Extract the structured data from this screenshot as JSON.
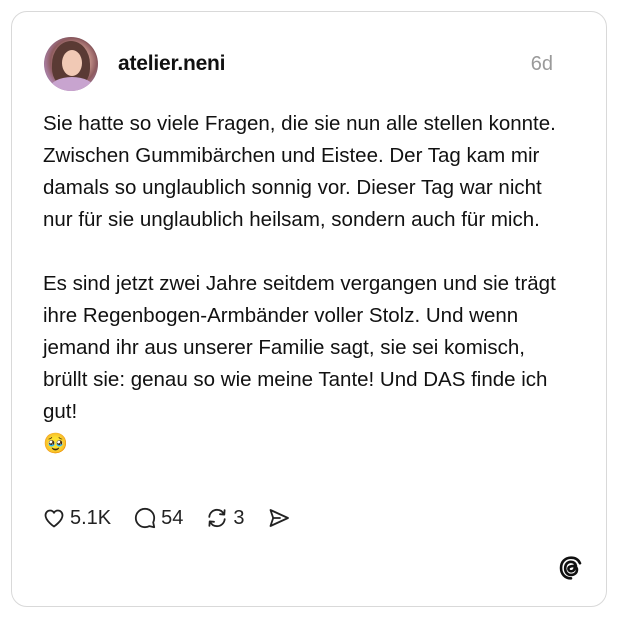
{
  "post": {
    "username": "atelier.neni",
    "timestamp": "6d",
    "paragraph_1": "Sie hatte so viele Fragen, die sie nun alle stellen konnte. Zwischen Gummibärchen und Eistee. Der Tag kam mir damals so unglaublich sonnig vor. Dieser Tag war nicht nur für sie unglaublich heilsam, sondern auch für mich.",
    "paragraph_2": "Es sind jetzt zwei Jahre seitdem vergangen und sie trägt ihre Regenbogen-Armbänder voller Stolz. Und wenn jemand ihr aus unserer Familie sagt, sie sei komisch, brüllt sie: genau so wie meine Tante! Und DAS finde ich gut!",
    "emoji": "🥹"
  },
  "actions": {
    "likes": "5.1K",
    "replies": "54",
    "reposts": "3"
  },
  "icons": {
    "like": "heart-icon",
    "reply": "comment-icon",
    "repost": "repost-icon",
    "share": "share-icon",
    "brand": "threads-logo-icon"
  },
  "colors": {
    "text": "#111111",
    "muted": "#9a9a9a",
    "border": "#d9d9d9"
  }
}
